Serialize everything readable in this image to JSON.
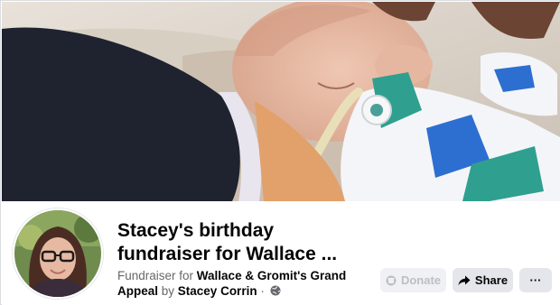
{
  "cover": {
    "icon": "baby-photo"
  },
  "fundraiser": {
    "title_line1": "Stacey's birthday",
    "title_line2": "fundraiser for Wallace ...",
    "prefix": "Fundraiser for ",
    "organization_line1": "Wallace & Gromit's Grand",
    "organization_line2": "Appeal",
    "by_text": " by ",
    "organizer": "Stacey Corrin",
    "separator": " · ",
    "privacy_icon": "globe-icon"
  },
  "actions": {
    "donate_label": "Donate",
    "share_label": "Share",
    "more_label": "···"
  },
  "colors": {
    "button_bg": "#e4e6eb",
    "disabled_text": "#bcc0c4",
    "secondary_text": "#65676b",
    "primary_text": "#050505"
  }
}
